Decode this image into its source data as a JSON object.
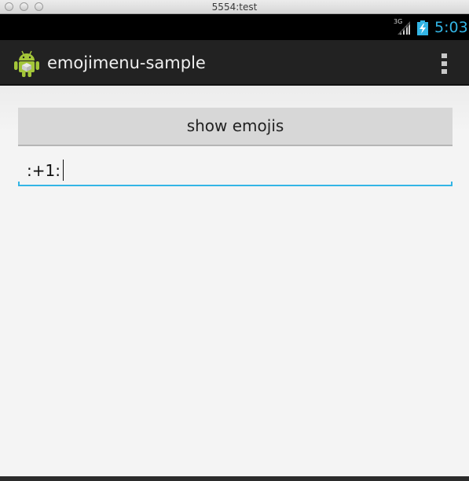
{
  "window": {
    "title": "5554:test"
  },
  "statusbar": {
    "network": "3G",
    "time": "5:03",
    "accent_color": "#33b5e5",
    "signal_icon": "signal-bars-icon",
    "battery_icon": "battery-charging-icon"
  },
  "actionbar": {
    "app_icon": "android-robot-icon",
    "title": "emojimenu-sample",
    "overflow_icon": "overflow-menu-icon"
  },
  "main": {
    "show_button_label": "show emojis",
    "edit_text_value": ":+1:"
  }
}
